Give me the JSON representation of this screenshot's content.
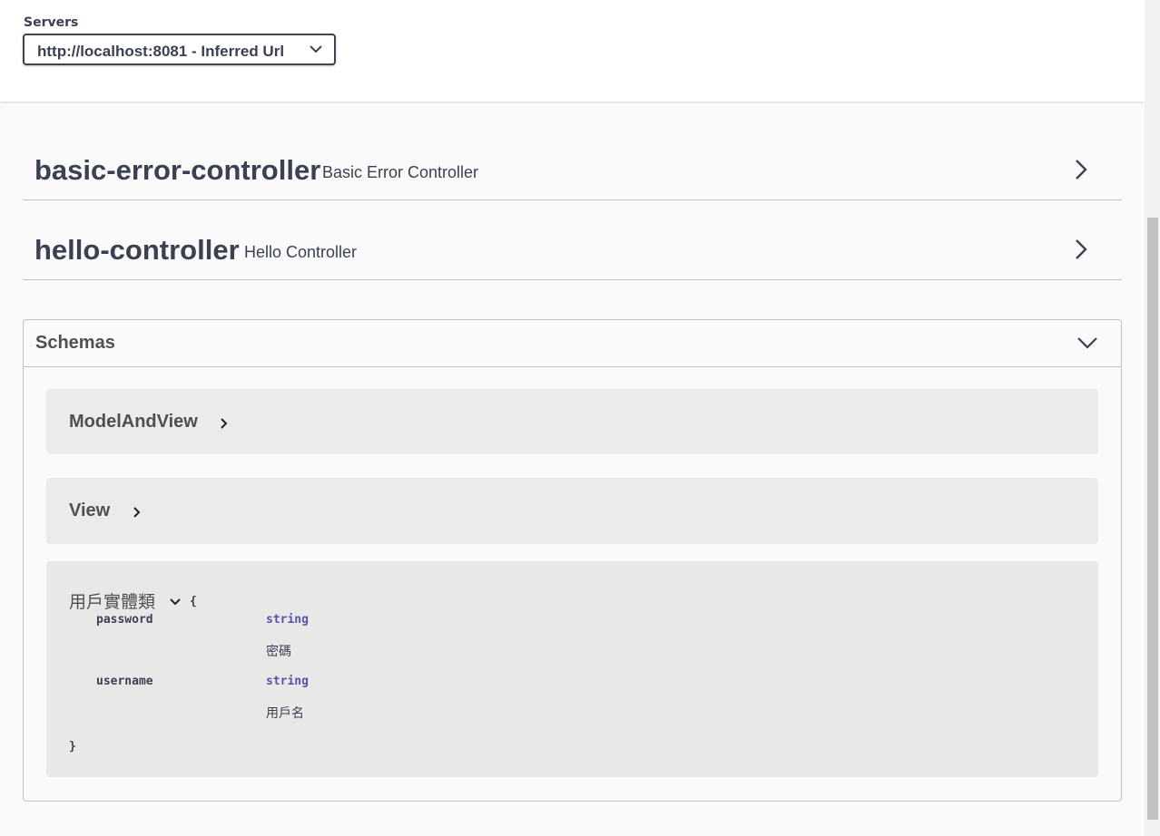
{
  "servers": {
    "label": "Servers",
    "selected": "http://localhost:8081 - Inferred Url"
  },
  "tags": [
    {
      "name": "basic-error-controller",
      "description": "Basic Error Controller"
    },
    {
      "name": "hello-controller",
      "description": "Hello Controller"
    }
  ],
  "schemas": {
    "title": "Schemas",
    "models": [
      {
        "name": "ModelAndView"
      },
      {
        "name": "View"
      }
    ],
    "expanded_model": {
      "name": "用戶實體類",
      "open_brace": "{",
      "close_brace": "}",
      "properties": [
        {
          "name": "password",
          "type": "string",
          "description": "密碼"
        },
        {
          "name": "username",
          "type": "string",
          "description": "用戶名"
        }
      ]
    }
  },
  "icons": {
    "server_dropdown": "chevron-down-icon",
    "tag_expand": "chevron-right-icon",
    "schemas_collapse": "chevron-down-icon"
  },
  "colors": {
    "text": "#3b4151",
    "type": "#5555aa",
    "model_bg": "#ebebeb"
  }
}
